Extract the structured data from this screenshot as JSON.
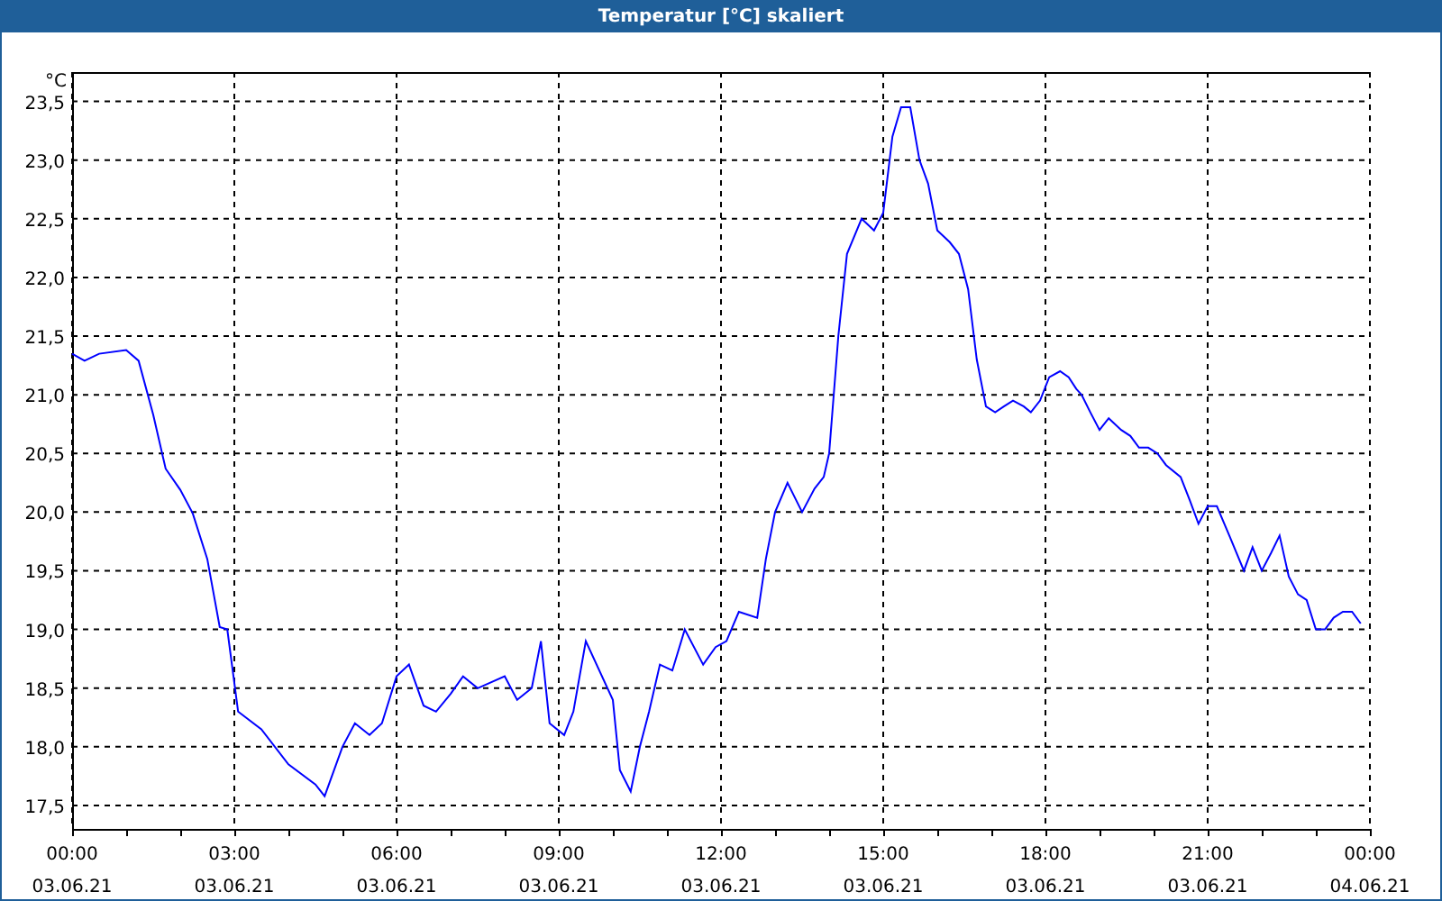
{
  "window": {
    "title": "Temperatur [°C] skaliert"
  },
  "chart": {
    "tick_dates": [
      "03.06.21",
      "03.06.21",
      "03.06.21",
      "03.06.21",
      "03.06.21",
      "03.06.21",
      "03.06.21",
      "03.06.21",
      "04.06.21"
    ],
    "chart_data": {
      "type": "line",
      "grid": true,
      "ylabel": "°C",
      "xlim": [
        0,
        24
      ],
      "ylim": [
        17.3,
        23.75
      ],
      "xticks": [
        {
          "value": 0,
          "label": "00:00"
        },
        {
          "value": 3,
          "label": "03:00"
        },
        {
          "value": 6,
          "label": "06:00"
        },
        {
          "value": 9,
          "label": "09:00"
        },
        {
          "value": 12,
          "label": "12:00"
        },
        {
          "value": 15,
          "label": "15:00"
        },
        {
          "value": 18,
          "label": "18:00"
        },
        {
          "value": 21,
          "label": "21:00"
        },
        {
          "value": 24,
          "label": "00:00"
        }
      ],
      "yticks": [
        {
          "value": 17.5,
          "label": "17,5"
        },
        {
          "value": 18,
          "label": "18,0"
        },
        {
          "value": 18.5,
          "label": "18,5"
        },
        {
          "value": 19,
          "label": "19,0"
        },
        {
          "value": 19.5,
          "label": "19,5"
        },
        {
          "value": 20,
          "label": "20,0"
        },
        {
          "value": 20.5,
          "label": "20,5"
        },
        {
          "value": 21,
          "label": "21,0"
        },
        {
          "value": 21.5,
          "label": "21,5"
        },
        {
          "value": 22,
          "label": "22,0"
        },
        {
          "value": 22.5,
          "label": "22,5"
        },
        {
          "value": 23,
          "label": "23,0"
        },
        {
          "value": 23.5,
          "label": "23,5"
        }
      ],
      "x": [
        0,
        0.23,
        0.5,
        1,
        1.23,
        1.5,
        1.73,
        2,
        2.23,
        2.5,
        2.73,
        2.87,
        3.07,
        3.5,
        4,
        4.5,
        4.67,
        5,
        5.23,
        5.5,
        5.73,
        6,
        6.23,
        6.5,
        6.73,
        7,
        7.23,
        7.5,
        8,
        8.23,
        8.5,
        8.67,
        8.83,
        9.1,
        9.27,
        9.5,
        10,
        10.13,
        10.33,
        10.5,
        10.67,
        10.87,
        11.1,
        11.33,
        11.67,
        11.9,
        12.1,
        12.33,
        12.67,
        12.83,
        13,
        13.23,
        13.5,
        13.73,
        13.9,
        14,
        14.17,
        14.33,
        14.6,
        14.83,
        15,
        15.17,
        15.33,
        15.5,
        15.67,
        15.83,
        16,
        16.23,
        16.4,
        16.57,
        16.73,
        16.9,
        17.07,
        17.23,
        17.4,
        17.6,
        17.73,
        17.9,
        18.07,
        18.27,
        18.43,
        18.57,
        18.67,
        18.83,
        19,
        19.17,
        19.4,
        19.57,
        19.73,
        19.9,
        20.07,
        20.23,
        20.5,
        20.67,
        20.83,
        21,
        21.17,
        21.4,
        21.67,
        21.83,
        22,
        22.17,
        22.33,
        22.5,
        22.67,
        22.83,
        23,
        23.17,
        23.33,
        23.5,
        23.67,
        23.83
      ],
      "series": [
        {
          "color": "#0000ff",
          "values": [
            21.35,
            21.29,
            21.35,
            21.38,
            21.29,
            20.83,
            20.37,
            20.19,
            19.99,
            19.6,
            19.02,
            19.0,
            18.3,
            18.15,
            17.85,
            17.68,
            17.58,
            18.0,
            18.2,
            18.1,
            18.2,
            18.6,
            18.7,
            18.35,
            18.3,
            18.45,
            18.6,
            18.5,
            18.6,
            18.4,
            18.5,
            18.9,
            18.2,
            18.1,
            18.3,
            18.9,
            18.4,
            17.8,
            17.62,
            18.0,
            18.3,
            18.7,
            18.65,
            19.0,
            18.7,
            18.85,
            18.9,
            19.15,
            19.1,
            19.6,
            20.0,
            20.25,
            20.0,
            20.2,
            20.3,
            20.5,
            21.5,
            22.2,
            22.5,
            22.4,
            22.55,
            23.2,
            23.45,
            23.45,
            23.0,
            22.8,
            22.4,
            22.3,
            22.2,
            21.9,
            21.3,
            20.9,
            20.85,
            20.9,
            20.95,
            20.9,
            20.85,
            20.95,
            21.15,
            21.2,
            21.15,
            21.05,
            21.0,
            20.85,
            20.7,
            20.8,
            20.7,
            20.65,
            20.55,
            20.55,
            20.5,
            20.4,
            20.3,
            20.1,
            19.9,
            20.05,
            20.05,
            19.8,
            19.5,
            19.7,
            19.5,
            19.65,
            19.8,
            19.45,
            19.3,
            19.25,
            19.0,
            19.0,
            19.1,
            19.15,
            19.15,
            19.05
          ]
        }
      ]
    }
  }
}
